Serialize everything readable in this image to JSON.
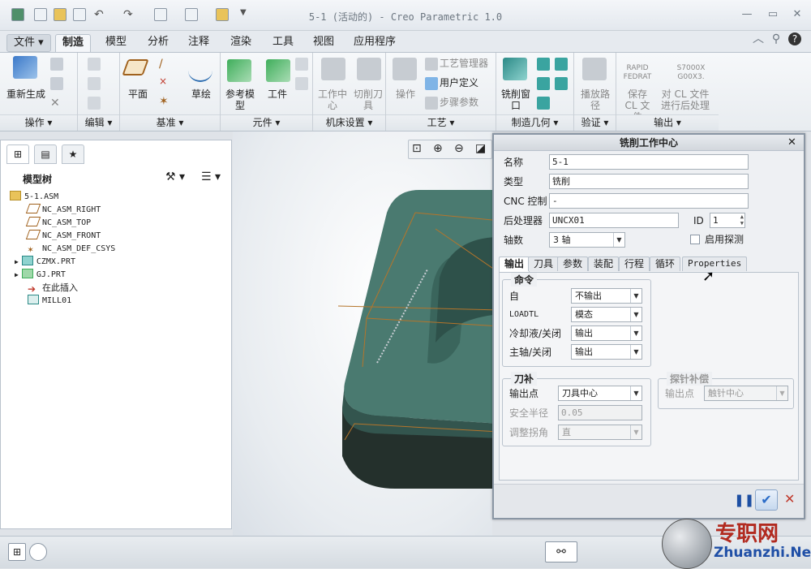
{
  "window": {
    "title": "5-1 (活动的) - Creo Parametric 1.0"
  },
  "tabs": [
    {
      "label": "文件"
    },
    {
      "label": "制造"
    },
    {
      "label": "模型"
    },
    {
      "label": "分析"
    },
    {
      "label": "注释"
    },
    {
      "label": "渲染"
    },
    {
      "label": "工具"
    },
    {
      "label": "视图"
    },
    {
      "label": "应用程序"
    }
  ],
  "ribbon": {
    "operation": {
      "regen": "重新生成",
      "footer": "操作"
    },
    "edit": {
      "footer": "编辑"
    },
    "datum": {
      "plane": "平面",
      "sketch": "草绘",
      "footer": "基准"
    },
    "component": {
      "ref_model": "参考模型",
      "workpiece": "工件",
      "footer": "元件"
    },
    "machine": {
      "work_center": "工作中心",
      "cutting_tool": "切削刀具",
      "footer": "机床设置"
    },
    "process": {
      "operation": "操作",
      "process_manager": "工艺管理器",
      "user_defined": "用户定义",
      "step_params": "步骤参数",
      "footer": "工艺"
    },
    "mfg_geom": {
      "mill_window": "铣削窗口",
      "footer": "制造几何"
    },
    "verify": {
      "play_path": "播放路径",
      "footer": "验证"
    },
    "output": {
      "rapid": "RAPID FEDRAT",
      "s7000": "S7000X G00X3.",
      "save_cl": "保存 CL 文件",
      "post_cl": "对 CL 文件进行后处理",
      "footer": "输出"
    }
  },
  "model_tree": {
    "title": "模型树",
    "items": [
      {
        "label": "5-1.ASM"
      },
      {
        "label": "NC_ASM_RIGHT"
      },
      {
        "label": "NC_ASM_TOP"
      },
      {
        "label": "NC_ASM_FRONT"
      },
      {
        "label": "NC_ASM_DEF_CSYS"
      },
      {
        "label": "CZMX.PRT"
      },
      {
        "label": "GJ.PRT"
      },
      {
        "label": "在此插入"
      },
      {
        "label": "MILL01"
      }
    ]
  },
  "dialog": {
    "title": "铣削工作中心",
    "name_label": "名称",
    "name_value": "5-1",
    "type_label": "类型",
    "type_value": "铣削",
    "cnc_label": "CNC 控制",
    "cnc_value": "-",
    "post_label": "后处理器",
    "post_value": "UNCX01",
    "id_label": "ID",
    "id_value": "1",
    "axes_label": "轴数",
    "axes_value": "3 轴",
    "probe_label": "启用探测",
    "tabs": [
      "输出",
      "刀具",
      "参数",
      "装配",
      "行程",
      "循环",
      "Properties"
    ],
    "commands": {
      "legend": "命令",
      "from_label": "自",
      "from_value": "不输出",
      "loadtl_label": "LOADTL",
      "loadtl_value": "模态",
      "coolant_label": "冷却液/关闭",
      "coolant_value": "输出",
      "spindle_label": "主轴/关闭",
      "spindle_value": "输出"
    },
    "cutter_comp": {
      "legend": "刀补",
      "output_point_label": "输出点",
      "output_point_value": "刀具中心",
      "safe_radius_label": "安全半径",
      "safe_radius_value": "0.05",
      "adjust_corner_label": "调整拐角",
      "adjust_corner_value": "直"
    },
    "probe_comp": {
      "legend": "探针补偿",
      "output_point_label": "输出点",
      "output_point_value": "触针中心"
    }
  },
  "watermark": {
    "brand": "专职网",
    "url": "Zhuanzhi.Net"
  }
}
